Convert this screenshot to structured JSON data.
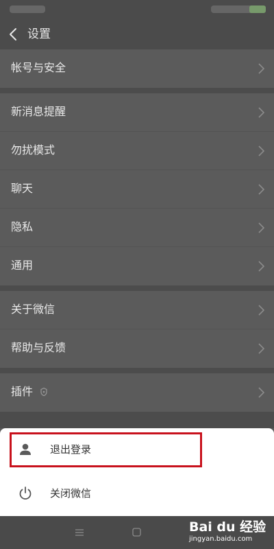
{
  "header": {
    "title": "设置"
  },
  "settings": {
    "groups": [
      {
        "items": [
          {
            "label": "帐号与安全"
          }
        ]
      },
      {
        "items": [
          {
            "label": "新消息提醒"
          },
          {
            "label": "勿扰模式"
          },
          {
            "label": "聊天"
          },
          {
            "label": "隐私"
          },
          {
            "label": "通用"
          }
        ]
      },
      {
        "items": [
          {
            "label": "关于微信"
          },
          {
            "label": "帮助与反馈"
          }
        ]
      },
      {
        "items": [
          {
            "label": "插件"
          }
        ]
      }
    ]
  },
  "sheet": {
    "logout_label": "退出登录",
    "close_label": "关闭微信"
  },
  "watermark": {
    "main": "Bai du 经验",
    "sub": "jingyan.baidu.com"
  },
  "icons": {
    "back": "chevron-left-icon",
    "chevron": "chevron-right-icon",
    "plugin": "plugin-icon",
    "logout": "user-icon",
    "power": "power-icon",
    "nav_menu": "menu-icon",
    "nav_home": "home-square-icon"
  },
  "colors": {
    "highlight": "#c8111c",
    "sheet_bg": "#ffffff",
    "dim_bg": "#5b5b5b"
  }
}
